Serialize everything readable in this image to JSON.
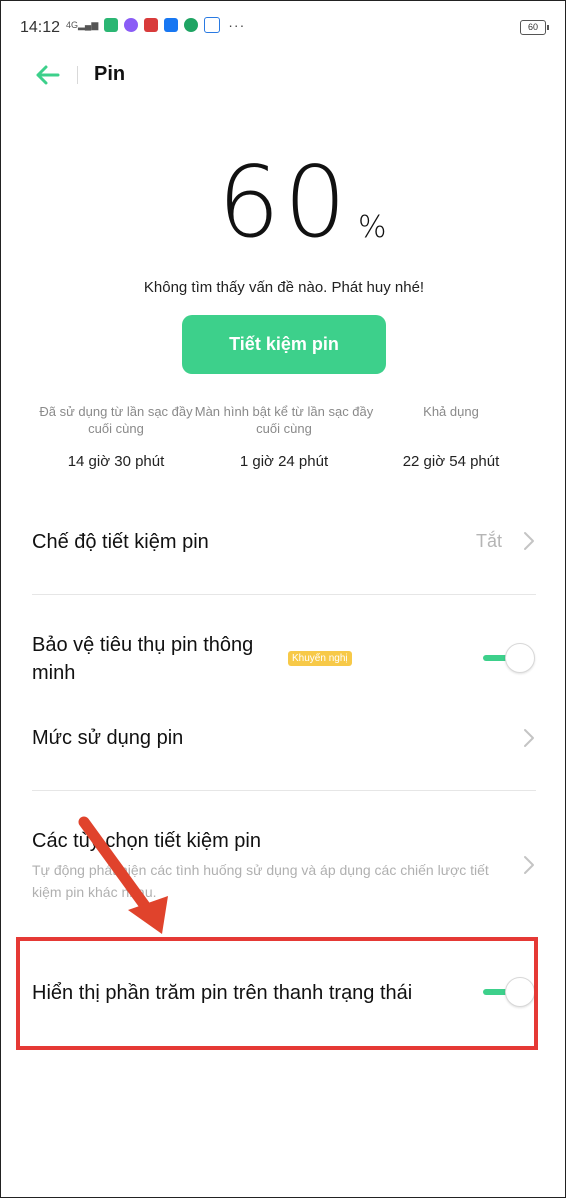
{
  "status_bar": {
    "time": "14:12",
    "network": "4G",
    "battery": "60",
    "notification_icons": [
      "signal-icon",
      "line-icon",
      "messenger-icon",
      "news-icon",
      "facebook-icon",
      "chat-icon",
      "zing-icon"
    ],
    "more": "···"
  },
  "header": {
    "title": "Pin"
  },
  "battery": {
    "percent": "60",
    "unit": "%",
    "message": "Không tìm thấy vấn đề nào. Phát huy nhé!",
    "save_button": "Tiết kiệm pin"
  },
  "stats": [
    {
      "label": "Đã sử dụng từ lần sạc đầy cuối cùng",
      "value": "14 giờ 30 phút"
    },
    {
      "label": "Màn hình bật kể từ lần sạc đầy cuối cùng",
      "value": "1 giờ 24 phút"
    },
    {
      "label": "Khả dụng",
      "value": "22 giờ 54 phút"
    }
  ],
  "settings": {
    "saving_mode": {
      "title": "Chế độ tiết kiệm pin",
      "value": "Tắt"
    },
    "smart_protect": {
      "title": "Bảo vệ tiêu thụ pin thông minh",
      "badge": "Khuyến nghị",
      "enabled": true
    },
    "usage": {
      "title": "Mức sử dụng pin"
    },
    "options": {
      "title": "Các tùy chọn tiết kiệm pin",
      "subtitle": "Tự động phát hiện các tình huống sử dụng và áp dụng các chiến lược tiết kiệm pin khác nhau."
    },
    "show_percent": {
      "title": "Hiển thị phần trăm pin trên thanh trạng thái",
      "enabled": true
    }
  },
  "colors": {
    "accent": "#3dd08b",
    "highlight": "#e53935",
    "arrow": "#e0432c",
    "badge": "#f7c948"
  }
}
